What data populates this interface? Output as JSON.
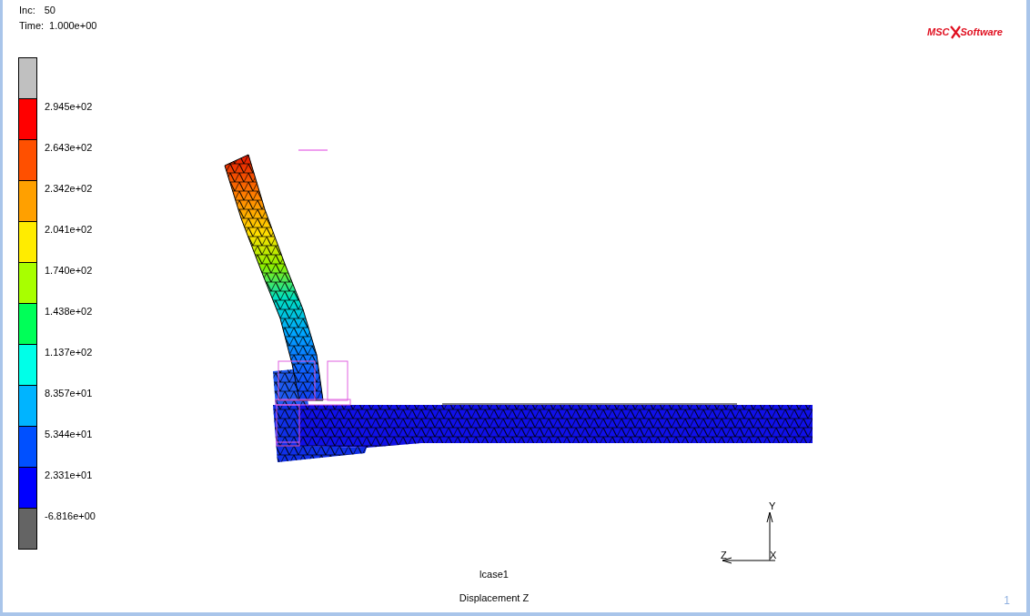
{
  "header": {
    "increment_label": "Inc:",
    "increment": "50",
    "time_label": "Time:",
    "time": "1.000e+00"
  },
  "logo": {
    "left": "MSC",
    "right": "Software"
  },
  "legend": {
    "bands": [
      {
        "color": "#c0c0c0"
      },
      {
        "color": "#ff0000"
      },
      {
        "color": "#ff5000"
      },
      {
        "color": "#ffa000"
      },
      {
        "color": "#ffec00"
      },
      {
        "color": "#a8ff00"
      },
      {
        "color": "#00ff58"
      },
      {
        "color": "#00ffe8"
      },
      {
        "color": "#00b4ff"
      },
      {
        "color": "#0050ff"
      },
      {
        "color": "#0000ff"
      },
      {
        "color": "#646464"
      }
    ],
    "labels": [
      "2.945e+02",
      "2.643e+02",
      "2.342e+02",
      "2.041e+02",
      "1.740e+02",
      "1.438e+02",
      "1.137e+02",
      "8.357e+01",
      "5.344e+01",
      "2.331e+01",
      "-6.816e+00"
    ]
  },
  "axes": {
    "y": "Y",
    "z": "Z",
    "x": "X"
  },
  "footer": {
    "load_case": "lcase1",
    "result": "Displacement Z",
    "page": "1"
  }
}
